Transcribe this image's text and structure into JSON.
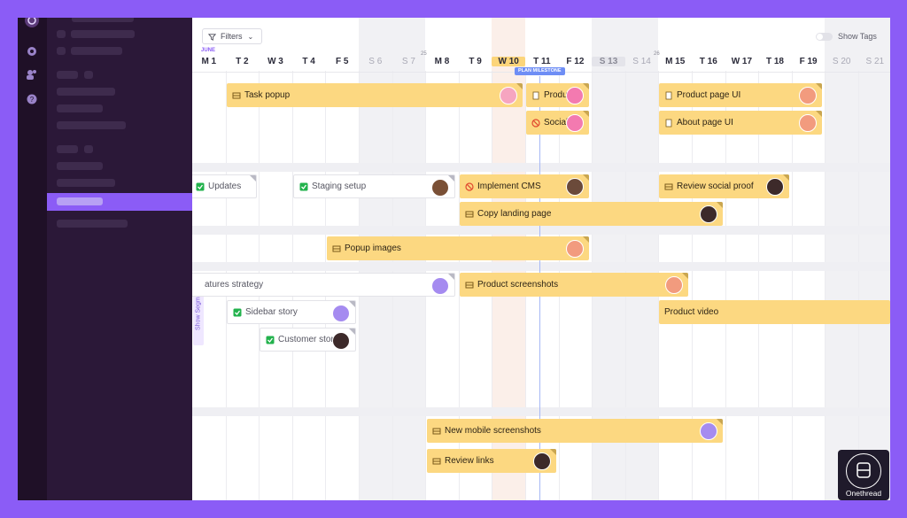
{
  "filters_label": "Filters",
  "show_tags_label": "Show Tags",
  "show_segments_label": "Show Segments",
  "month_label": "JUNE",
  "milestone_label": "PLAN MILESTONE",
  "week_numbers": [
    "25",
    "26"
  ],
  "days": [
    "M 1",
    "T 2",
    "W 3",
    "T 4",
    "F 5",
    "S 6",
    "S 7",
    "M 8",
    "T 9",
    "W 10",
    "T 11",
    "F 12",
    "S 13",
    "S 14",
    "M 15",
    "T 16",
    "W 17",
    "T 18",
    "F 19",
    "S 20",
    "S 21"
  ],
  "today_label": "W 10",
  "tasks": [
    {
      "label": "Task popup"
    },
    {
      "label": "Produc"
    },
    {
      "label": "Product page UI"
    },
    {
      "label": "Social"
    },
    {
      "label": "About page UI"
    },
    {
      "label": "Updates"
    },
    {
      "label": "Staging setup"
    },
    {
      "label": "Implement CMS"
    },
    {
      "label": "Review social proof"
    },
    {
      "label": "Copy landing page"
    },
    {
      "label": "Popup images"
    },
    {
      "label": "atures strategy"
    },
    {
      "label": "Product screenshots"
    },
    {
      "label": "Sidebar story"
    },
    {
      "label": "Product video"
    },
    {
      "label": "Customer storie"
    },
    {
      "label": "New mobile screenshots"
    },
    {
      "label": "Review links"
    }
  ],
  "brand": {
    "name": "Onethread"
  },
  "colors": {
    "accent": "#8b5cf6",
    "task": "#fcd881",
    "milestone": "#6e8ef5"
  }
}
